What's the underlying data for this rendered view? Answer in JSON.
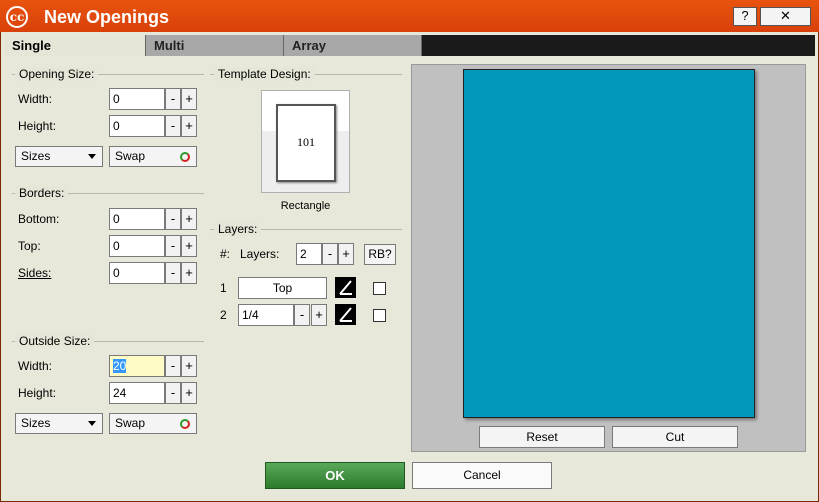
{
  "window": {
    "title": "New Openings",
    "help_label": "?",
    "close_label": "✕"
  },
  "tabs": [
    {
      "label": "Single",
      "active": true
    },
    {
      "label": "Multi",
      "active": false
    },
    {
      "label": "Array",
      "active": false
    }
  ],
  "opening_size": {
    "title": "Opening Size:",
    "width_label": "Width:",
    "width_value": "0",
    "height_label": "Height:",
    "height_value": "0",
    "sizes_label": "Sizes",
    "swap_label": "Swap"
  },
  "borders": {
    "title": "Borders:",
    "bottom_label": "Bottom:",
    "bottom_value": "0",
    "top_label": "Top:",
    "top_value": "0",
    "sides_label": "Sides:",
    "sides_value": "0"
  },
  "outside_size": {
    "title": "Outside Size:",
    "width_label": "Width:",
    "width_value": "20",
    "height_label": "Height:",
    "height_value": "24",
    "sizes_label": "Sizes",
    "swap_label": "Swap"
  },
  "spin": {
    "minus": "-",
    "plus": "+"
  },
  "template_design": {
    "title": "Template Design:",
    "number": "101",
    "name": "Rectangle"
  },
  "layers": {
    "title": "Layers:",
    "count_prefix": "#:",
    "count_label": "Layers:",
    "count_value": "2",
    "rb_label": "RB?",
    "rows": [
      {
        "index": "1",
        "value": "Top"
      },
      {
        "index": "2",
        "value": "1/4"
      }
    ]
  },
  "preview": {
    "color": "#0099bb",
    "reset_label": "Reset",
    "cut_label": "Cut"
  },
  "footer": {
    "ok_label": "OK",
    "cancel_label": "Cancel"
  }
}
